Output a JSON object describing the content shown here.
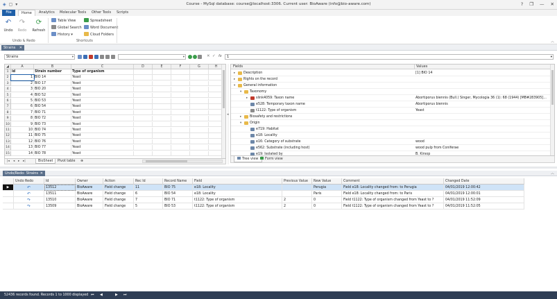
{
  "window": {
    "title": "Course - MySql database: course@localhost:3306. Current user: BioAware (info@bio-aware.com)",
    "qat_icons": [
      "app-icon",
      "save-icon",
      "customize-icon"
    ],
    "controls": [
      "?",
      "❐",
      "—",
      "✕"
    ]
  },
  "menu": {
    "tabs": [
      "File",
      "Home",
      "Analytics",
      "Molecular Tools",
      "Other Tools",
      "Scripts"
    ]
  },
  "ribbon": {
    "undo": "Undo",
    "redo": "Redo",
    "refresh": "Refresh",
    "undo_redo_group": "Undo & Redo",
    "table_view": "Table View",
    "global_search": "Global Search",
    "history": "History",
    "spreadsheet": "Spreadsheet",
    "word_document": "Word Document",
    "cloud_folders": "Cloud Folders",
    "shortcuts_group": "Shortcuts"
  },
  "doc_tab": {
    "label": "Strains",
    "close": "✕"
  },
  "toolbar": {
    "table_combo": "Strains",
    "cell_value": "1"
  },
  "sheet": {
    "columns": [
      "A",
      "B",
      "C",
      "D",
      "E",
      "F",
      "G",
      "H"
    ],
    "header_row": [
      "id",
      "Strain number",
      "Type of organism"
    ],
    "rows": [
      [
        "1",
        "BIO 14",
        "Yeast"
      ],
      [
        "2",
        "BIO 17",
        "Yeast"
      ],
      [
        "3",
        "BIO 20",
        "Yeast"
      ],
      [
        "4",
        "BIO 52",
        "Yeast"
      ],
      [
        "5",
        "BIO 53",
        "Yeast"
      ],
      [
        "6",
        "BIO 54",
        "Yeast"
      ],
      [
        "7",
        "BIO 71",
        "Yeast"
      ],
      [
        "8",
        "BIO 72",
        "Yeast"
      ],
      [
        "9",
        "BIO 73",
        "Yeast"
      ],
      [
        "10",
        "BIO 74",
        "Yeast"
      ],
      [
        "11",
        "BIO 75",
        "Yeast"
      ],
      [
        "12",
        "BIO 76",
        "Yeast"
      ],
      [
        "13",
        "BIO 77",
        "Yeast"
      ],
      [
        "14",
        "BIO 78",
        "Yeast"
      ]
    ],
    "row_numbers": [
      "1",
      "2",
      "3",
      "4",
      "5",
      "6",
      "7",
      "8",
      "9",
      "10",
      "11",
      "12",
      "13",
      "14",
      "15"
    ],
    "tabs": [
      "BioSheet",
      "Pivot table"
    ],
    "add_tab": "⊕"
  },
  "tree": {
    "col_fields": "Fields",
    "col_values": "Values",
    "rows": [
      {
        "indent": 0,
        "exp": "▸",
        "icon": "folder",
        "label": "Description",
        "value": "[1] BIO 14"
      },
      {
        "indent": 0,
        "exp": "▸",
        "icon": "folder",
        "label": "Rights on the record",
        "value": ""
      },
      {
        "indent": 0,
        "exp": "▾",
        "icon": "folder",
        "label": "General information",
        "value": ""
      },
      {
        "indent": 1,
        "exp": "▾",
        "icon": "folder",
        "label": "Taxonomy",
        "value": ""
      },
      {
        "indent": 2,
        "exp": "▸",
        "icon": "tax",
        "label": "slink4059: Taxon name",
        "value": "Abortiporus biennis (Bull.) Singer, Mycologia 36 (1): 68 (1944) [MB#283905]..."
      },
      {
        "indent": 2,
        "exp": "",
        "icon": "field",
        "label": "e528: Temporary taxon name",
        "value": "Abortiporus biennis"
      },
      {
        "indent": 2,
        "exp": "",
        "icon": "mem",
        "label": "t1122: Type of organism",
        "value": "Yeast"
      },
      {
        "indent": 1,
        "exp": "▸",
        "icon": "folder",
        "label": "Biosafety and restrictions",
        "value": ""
      },
      {
        "indent": 1,
        "exp": "▾",
        "icon": "folder",
        "label": "Origin",
        "value": ""
      },
      {
        "indent": 2,
        "exp": "",
        "icon": "field",
        "label": "e719: Habitat",
        "value": ""
      },
      {
        "indent": 2,
        "exp": "",
        "icon": "field",
        "label": "e18: Locality",
        "value": ""
      },
      {
        "indent": 2,
        "exp": "",
        "icon": "field",
        "label": "e16: Category of substrate",
        "value": "wood"
      },
      {
        "indent": 2,
        "exp": "",
        "icon": "field",
        "label": "e562: Substrate (including host)",
        "value": "wood pulp from Coniferae"
      },
      {
        "indent": 2,
        "exp": "",
        "icon": "field",
        "label": "e19: Isolated by",
        "value": "B. Kirsop"
      }
    ],
    "view_tabs": [
      "Tree view",
      "Form view"
    ]
  },
  "panel": {
    "tab": "Undo/Redo: Strains",
    "close": "✕"
  },
  "history": {
    "headers": [
      "Undo Redo",
      "Id",
      "Owner",
      "Action",
      "Rec Id",
      "Record Name",
      "Field",
      "Previous Value",
      "New Value",
      "Comment",
      "Changed Date"
    ],
    "rows": [
      [
        "13512",
        "BioAware",
        "Field change",
        "11",
        "BIO 75",
        "e18: Locality",
        "",
        "Perugia",
        "Field e18: Locality changed from: to Perugia",
        "04/01/2019 12:00:42"
      ],
      [
        "13511",
        "BioAware",
        "Field change",
        "6",
        "BIO 54",
        "e18: Locality",
        "",
        "Paris",
        "Field e18: Locality changed from: to Paris",
        "04/01/2019 12:00:01"
      ],
      [
        "13510",
        "BioAware",
        "Field change",
        "7",
        "BIO 71",
        "t1122: Type of organism",
        "2",
        "0",
        "Field t1122: Type of organism changed from Yeast to ?",
        "04/01/2019 11:52:09"
      ],
      [
        "13509",
        "BioAware",
        "Field change",
        "5",
        "BIO 53",
        "t1122: Type of organism",
        "2",
        "0",
        "Field t1122: Type of organism changed from Yeast to ?",
        "04/01/2019 11:52:05"
      ]
    ],
    "undo_glyphs": [
      "↶",
      "↶",
      "↷",
      "↷"
    ]
  },
  "status": {
    "text": "52436 records found. Records 1 to 1000 displayed",
    "nav": [
      "⏮",
      "◀",
      "▶",
      "⏭"
    ]
  }
}
